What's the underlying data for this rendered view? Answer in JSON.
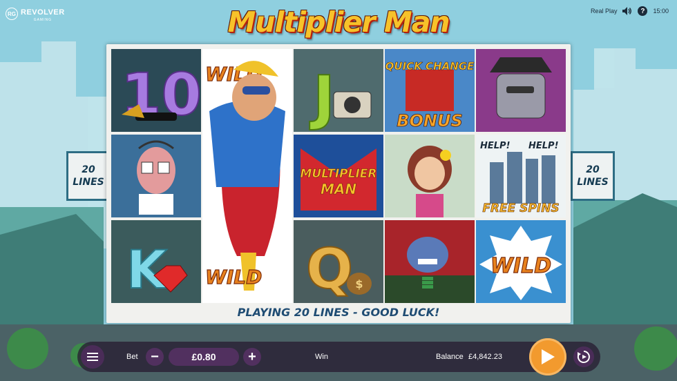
{
  "brand": {
    "logo_letters": "RG",
    "name": "REVOLVER",
    "sub": "GAMING"
  },
  "game_title": "Multiplier Man",
  "top_right": {
    "mode": "Real Play",
    "help_glyph": "?",
    "time": "15:00"
  },
  "lines_tag": {
    "number": "20",
    "word": "LINES"
  },
  "reels": [
    [
      "10",
      "Dice gangster",
      "K"
    ],
    [
      "WILD",
      "Multiplier Man hero",
      "WILD"
    ],
    [
      "J",
      "Multiplier Man",
      "Q"
    ],
    [
      "Quick Change Bonus",
      "Lady",
      "Shark"
    ],
    [
      "Slot machine villain",
      "Help! Help! Free Spins",
      "WILD"
    ]
  ],
  "symbol_labels": {
    "ten": "10",
    "wild": "WILD",
    "jack": "J",
    "king": "K",
    "queen": "Q",
    "multiplier_line1": "MULTIPLIER",
    "multiplier_line2": "MAN",
    "quick_change": "QUICK CHANGE",
    "bonus": "BONUS",
    "help": "HELP!",
    "free_spins": "FREE SPINS",
    "dollar": "$"
  },
  "status_message": "PLAYING 20 LINES - GOOD LUCK!",
  "controls": {
    "bet_label": "Bet",
    "bet_value": "£0.80",
    "minus": "−",
    "plus": "+",
    "win_label": "Win",
    "win_value": "",
    "balance_label": "Balance",
    "balance_value": "£4,842.23"
  },
  "icons": {
    "menu": "hamburger-icon",
    "spin": "play-icon",
    "autoplay": "autoplay-icon",
    "sound": "speaker-icon",
    "help": "help-icon"
  },
  "colors": {
    "spin_button": "#f29a2e",
    "control_purple": "#51305f",
    "title_gold": "#f7c22a",
    "status_blue": "#1f4c73"
  }
}
